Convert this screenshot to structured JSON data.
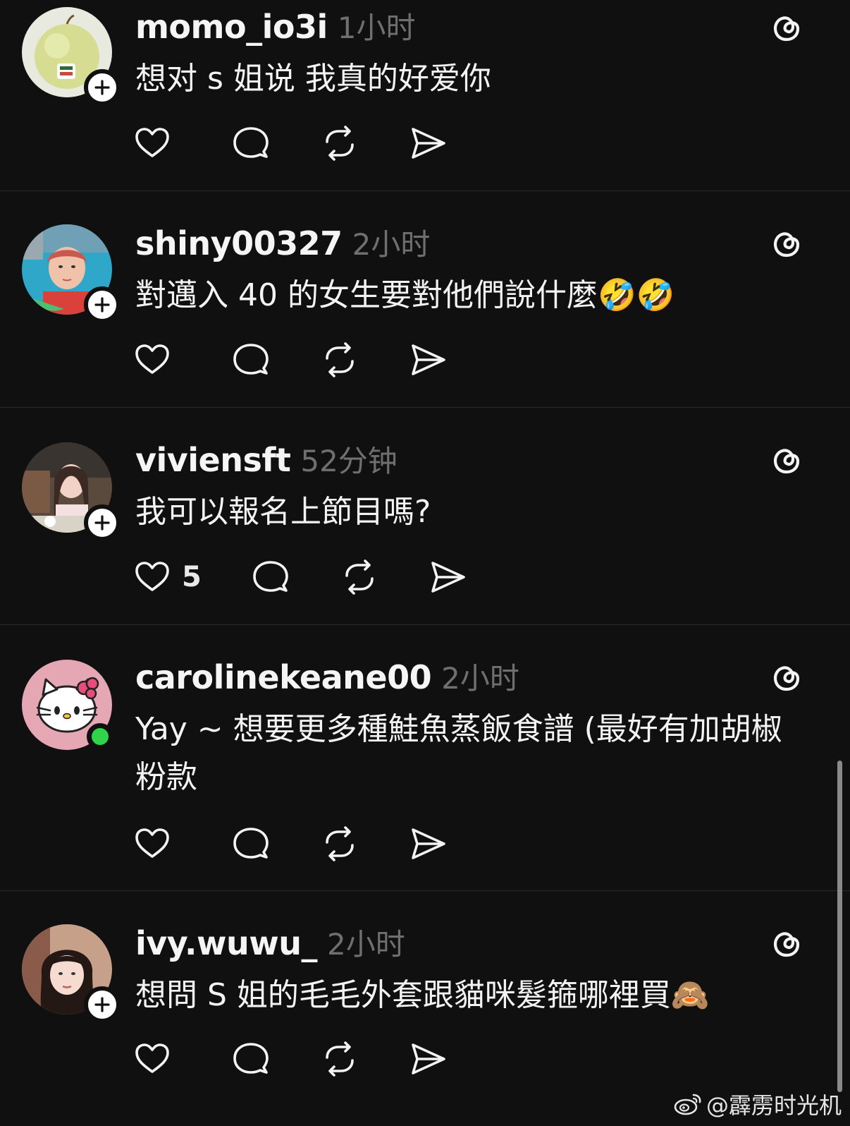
{
  "posts": [
    {
      "username": "momo_io3i",
      "time": "1小时",
      "text": "想对 s 姐说 我真的好爱你",
      "likes": "",
      "badge": "follow",
      "avatar": "apple"
    },
    {
      "username": "shiny00327",
      "time": "2小时",
      "text": "對邁入 40 的女生要對他們說什麼🤣🤣",
      "likes": "",
      "badge": "follow",
      "avatar": "pool-selfie"
    },
    {
      "username": "viviensft",
      "time": "52分钟",
      "text": "我可以報名上節目嗎?",
      "likes": "5",
      "badge": "follow",
      "avatar": "restaurant-photo"
    },
    {
      "username": "carolinekeane00",
      "time": "2小时",
      "text": "Yay ~ 想要更多種鮭魚蒸飯食譜 (最好有加胡椒粉款",
      "likes": "",
      "badge": "online",
      "avatar": "hello-kitty"
    },
    {
      "username": "ivy.wuwu_",
      "time": "2小时",
      "text": "想問 S 姐的毛毛外套跟貓咪髮箍哪裡買🙈",
      "likes": "",
      "badge": "follow",
      "avatar": "portrait"
    }
  ],
  "watermark": {
    "text": "@霹雳时光机",
    "icon": "weibo-icon"
  },
  "colors": {
    "background": "#101010",
    "text": "#f3f3f3",
    "muted": "#6f6f6f",
    "divider": "#2a2a2a",
    "online": "#2fd44a"
  }
}
